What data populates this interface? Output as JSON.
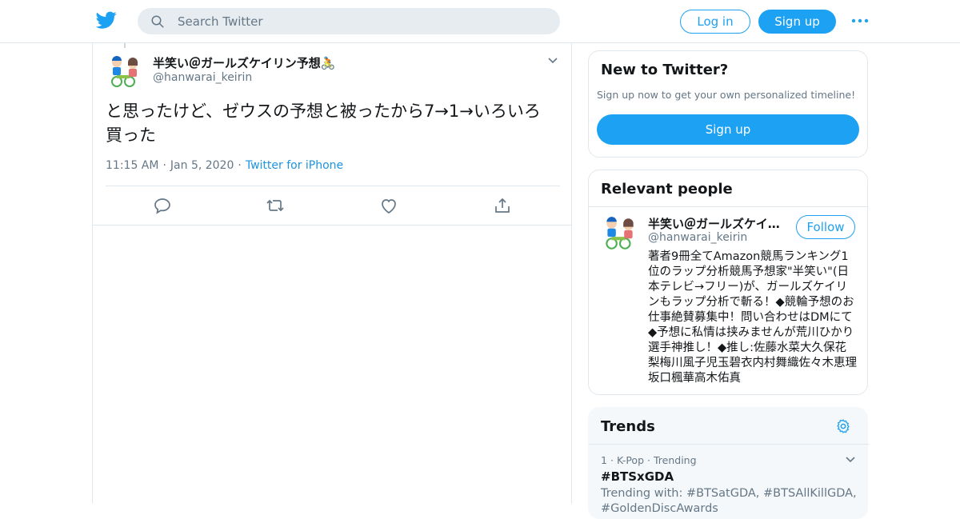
{
  "header": {
    "logo_icon": "twitter-bird-icon",
    "search_placeholder": "Search Twitter",
    "login_label": "Log in",
    "signup_label": "Sign up",
    "more_icon": "more-dots-icon",
    "accent_color": "#1da1f2"
  },
  "tweet": {
    "author_name": "半笑い＠ガールズケイリン予想🚴",
    "author_handle": "@hanwarai_keirin",
    "text": "と思ったけど、ゼウスの予想と被ったから7→1→いろいろ買った",
    "time": "11:15 AM",
    "date": "Jan 5, 2020",
    "source": "Twitter for iPhone",
    "actions": [
      "reply-icon",
      "retweet-icon",
      "like-icon",
      "share-icon"
    ]
  },
  "new_to_twitter": {
    "title": "New to Twitter?",
    "subtitle": "Sign up now to get your own personalized timeline!",
    "signup_label": "Sign up"
  },
  "relevant_people": {
    "title": "Relevant people",
    "person": {
      "name": "半笑い＠ガールズケイリン予想🚴",
      "handle": "@hanwarai_keirin",
      "follow_label": "Follow",
      "bio": "著者9冊全てAmazon競馬ランキング1位のラップ分析競馬予想家\"半笑い\"(日本テレビ→フリー)が、ガールズケイリンもラップ分析で斬る！◆競輪予想のお仕事絶賛募集中！問い合わせはDMにて◆予想に私情は挟みませんが荒川ひかり選手神推し！◆推し:佐藤水菜大久保花梨梅川風子児玉碧衣内村舞織佐々木恵理坂口楓華高木佑真"
    }
  },
  "trends": {
    "title": "Trends",
    "items": [
      {
        "rank": "1",
        "category": "K-Pop",
        "status": "Trending",
        "name": "#BTSxGDA",
        "trending_with": "Trending with: #BTSatGDA, #BTSAllKillGDA, #GoldenDiscAwards"
      }
    ]
  }
}
